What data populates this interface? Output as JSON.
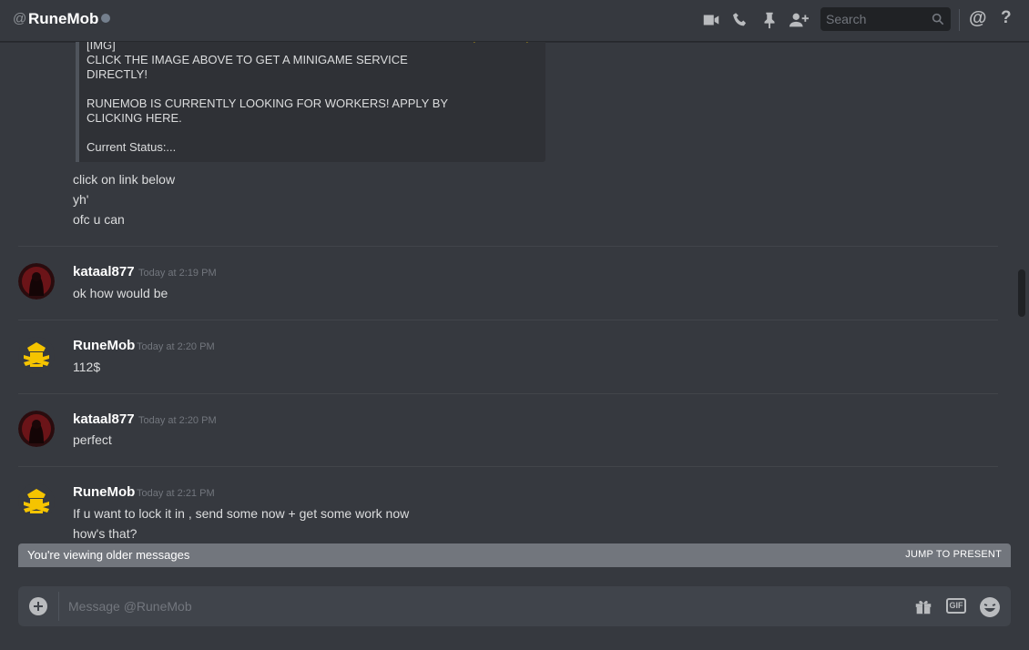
{
  "header": {
    "at_symbol": "@",
    "title": "RuneMob",
    "search_placeholder": "Search",
    "icons": [
      "video-icon",
      "phone-icon",
      "pin-icon",
      "add-member-icon",
      "search-icon",
      "mention-icon",
      "help-icon"
    ],
    "mention_label": "@",
    "help_label": "?"
  },
  "embed": {
    "lines": [
      "[IMG]",
      "CLICK THE IMAGE ABOVE TO GET A MINIGAME SERVICE",
      "DIRECTLY!",
      "RUNEMOB IS CURRENTLY LOOKING FOR WORKERS! APPLY BY",
      "CLICKING HERE.",
      "Current Status:..."
    ]
  },
  "continued_messages": [
    "click on link below",
    "yh'",
    "ofc u can"
  ],
  "messages": [
    {
      "author": "kataal877",
      "timestamp": "Today at 2:19 PM",
      "lines": [
        "ok how would be"
      ],
      "avatar": "dark-red"
    },
    {
      "author": "RuneMob",
      "timestamp": "Today at 2:20 PM",
      "lines": [
        "112$"
      ],
      "avatar": "gold-logo"
    },
    {
      "author": "kataal877",
      "timestamp": "Today at 2:20 PM",
      "lines": [
        "perfect"
      ],
      "avatar": "dark-red"
    },
    {
      "author": "RuneMob",
      "timestamp": "Today at 2:21 PM",
      "lines": [
        "If u want to lock it in , send some now + get some work now",
        "how's that?"
      ],
      "avatar": "gold-logo"
    }
  ],
  "older_bar": {
    "text": "You're viewing older messages",
    "jump": "JUMP TO PRESENT"
  },
  "composer": {
    "placeholder": "Message @RuneMob",
    "gif_label": "GIF"
  },
  "colors": {
    "background": "#36393f",
    "embed_bg": "#2f3136",
    "accent_gold": "#f5c400",
    "older_bar": "#72767d",
    "composer_bg": "#40444b"
  }
}
